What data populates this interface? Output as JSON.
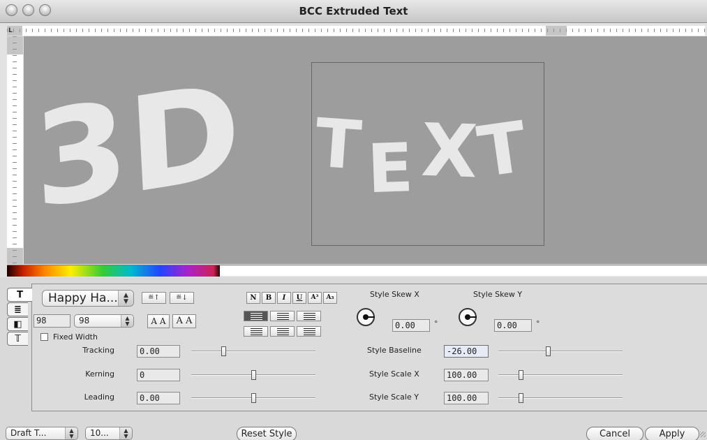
{
  "window": {
    "title": "BCC Extruded Text"
  },
  "canvas": {
    "ruler_corner": "L",
    "preview_text_left": "3D",
    "preview_text_right": [
      "T",
      "E",
      "X",
      "T"
    ],
    "background_color": "#9d9d9d",
    "text_color": "#e8e8e8"
  },
  "tabs": [
    {
      "name": "text-tab",
      "glyph": "T"
    },
    {
      "name": "paragraph-tab",
      "glyph": "≣"
    },
    {
      "name": "fill-tab",
      "glyph": "◧"
    },
    {
      "name": "outline-tab",
      "glyph": "𝕋"
    }
  ],
  "font": {
    "family_value": "Happy Ha...",
    "size_display": "98",
    "size_value": "98",
    "fixed_width_label": "Fixed Width",
    "fixed_width_checked": false
  },
  "size_buttons": {
    "increase_label": "≝↑",
    "decrease_label": "≝↓",
    "case_small_label": "A A",
    "case_large_label": "A A"
  },
  "style_buttons": [
    {
      "name": "normal",
      "label": "N"
    },
    {
      "name": "bold",
      "label": "B"
    },
    {
      "name": "italic",
      "label": "I"
    },
    {
      "name": "underline",
      "label": "U"
    },
    {
      "name": "superscript",
      "label": "A³"
    },
    {
      "name": "subscript",
      "label": "A₃"
    }
  ],
  "tracking": {
    "label": "Tracking",
    "value": "0.00",
    "level": 0.25
  },
  "kerning": {
    "label": "Kerning",
    "value": "0",
    "level": 0.5
  },
  "leading": {
    "label": "Leading",
    "value": "0.00",
    "level": 0.5
  },
  "skew_x": {
    "label": "Style Skew X",
    "value": "0.00",
    "unit": "°"
  },
  "skew_y": {
    "label": "Style Skew Y",
    "value": "0.00",
    "unit": "°"
  },
  "baseline": {
    "label": "Style Baseline",
    "value": "-26.00",
    "level": 0.4
  },
  "scale_x": {
    "label": "Style Scale X",
    "value": "100.00",
    "level": 0.17
  },
  "scale_y": {
    "label": "Style Scale Y",
    "value": "100.00",
    "level": 0.17
  },
  "footer": {
    "quality_value": "Draft T...",
    "zoom_value": "10...",
    "reset_label": "Reset Style",
    "cancel_label": "Cancel",
    "apply_label": "Apply"
  }
}
